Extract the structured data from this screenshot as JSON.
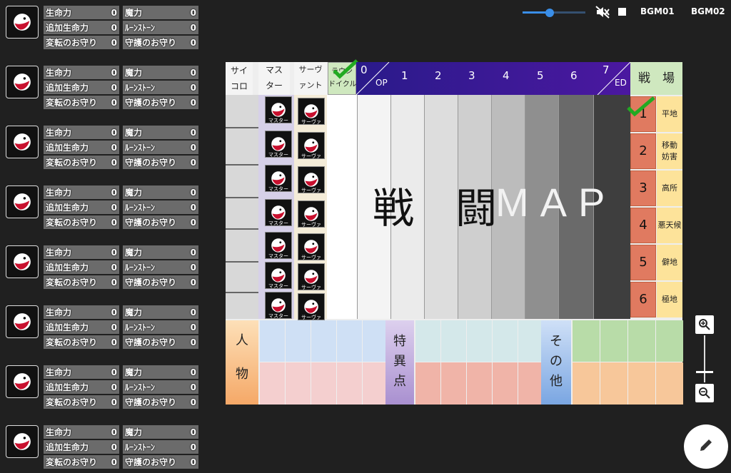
{
  "stats": {
    "hp_label": "生命力",
    "mp_label": "魔力",
    "bonus_hp_label": "追加生命力",
    "rune_label": "ﾙｰﾝｽﾄｰﾝ",
    "amulet1_label": "変転のお守り",
    "amulet2_label": "守護のお守り",
    "value": "0"
  },
  "top": {
    "bgm1": "BGM01",
    "bgm2": "BGM02",
    "volume_level": 0.5
  },
  "board": {
    "dice_label": "サイ\nコロ",
    "master_label": "マス\nター",
    "servant_label": "サーヴ\nァント",
    "round_label": "ラウン\nドイクル",
    "round_numbers": [
      "0",
      "1",
      "2",
      "3",
      "4",
      "5",
      "6",
      "7"
    ],
    "op_label": "OP",
    "ed_label": "ED",
    "battlefield_label": "戦　場",
    "center_title": "戦　闘",
    "center_map": "MAP",
    "mini_master": "マスター",
    "mini_servant": "サーヴァ",
    "fields": [
      {
        "num": "1",
        "name": "平地"
      },
      {
        "num": "2",
        "name": "移動\n妨害"
      },
      {
        "num": "3",
        "name": "高所"
      },
      {
        "num": "4",
        "name": "悪天候"
      },
      {
        "num": "5",
        "name": "僻地"
      },
      {
        "num": "6",
        "name": "極地"
      }
    ],
    "person_label": "人\n\n物",
    "special_label": "特\n異\n点",
    "other_label": "そ\nの\n他"
  },
  "colors": {
    "purple_bar": "#3a1190",
    "field_num_bg": "#e07a60",
    "field_name_bg": "#fde39a",
    "check": "#22aa22"
  }
}
